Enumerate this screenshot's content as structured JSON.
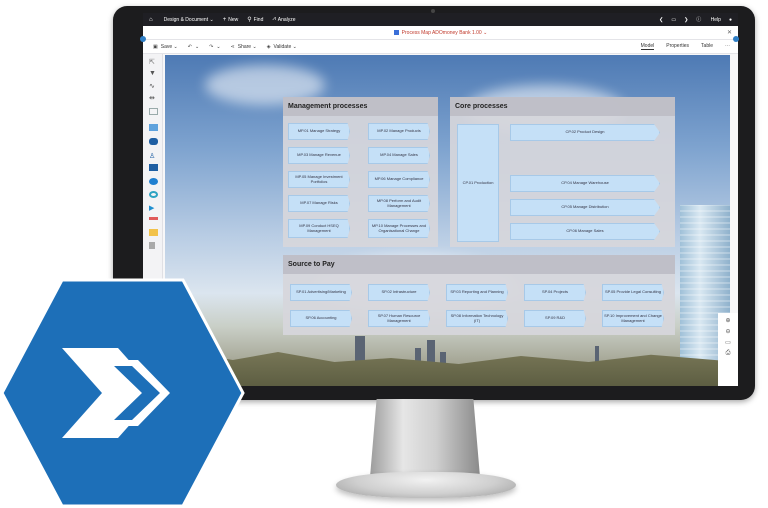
{
  "topbar": {
    "menu_label": "Design & Document",
    "new_label": "New",
    "find_label": "Find",
    "analyze_label": "Analyze",
    "help_label": "Help"
  },
  "document": {
    "title": "Process Map ADOmoney Bank 1.00"
  },
  "toolbar": {
    "save_label": "Save",
    "share_label": "Share",
    "validate_label": "Validate",
    "tabs": [
      "Model",
      "Properties",
      "Table"
    ]
  },
  "management": {
    "title": "Management processes",
    "items": [
      "MP.01 Manage Strategy",
      "MP.02 Manage Products",
      "MP.03 Manage Revenue",
      "MP.04 Manage Sales",
      "MP.05 Manage Investment Portfolios",
      "MP.06 Manage Compliance",
      "MP.07 Manage Risks",
      "MP.08 Perform and Audit Management",
      "MP.09 Conduct HSEQ Management",
      "MP.10 Manage Processes and Organisational Change"
    ]
  },
  "core": {
    "title": "Core processes",
    "production": "CP.01 Production",
    "items": [
      "CP.02 Product Design",
      "CP.04 Manage Warehouse",
      "CP.05 Manage Distribution",
      "CP.06 Manage Sales"
    ]
  },
  "source": {
    "title": "Source to Pay",
    "items": [
      "SP.01 Advertising/Marketing",
      "SP.02 Infrastructure",
      "SP.03 Reporting and Planning",
      "SP.04 Projects",
      "SP.05 Provide Legal Consulting",
      "SP.06 Accounting",
      "SP.07 Human Resource Management",
      "SP.08 Information Technology (IT)",
      "SP.09 R&D",
      "SP.10 Improvement and Change Management"
    ]
  },
  "colors": {
    "brand": "#1d6fb8",
    "process_fill": "#c5e0f7",
    "topbar": "#1f1f24"
  }
}
